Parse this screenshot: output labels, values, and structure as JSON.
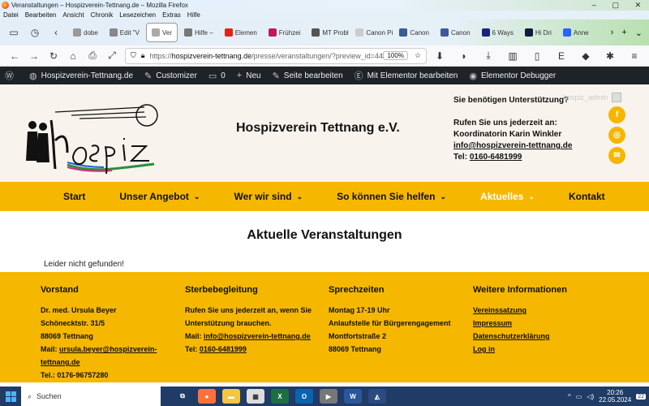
{
  "browser": {
    "window_title": "Veranstaltungen – Hospizverein-Tettnang.de – Mozilla Firefox",
    "menu": [
      "Datei",
      "Bearbeiten",
      "Ansicht",
      "Chronik",
      "Lesezeichen",
      "Extras",
      "Hilfe"
    ],
    "tabs": [
      {
        "label": "dobe",
        "color": "#999999"
      },
      {
        "label": "Edit \"V",
        "color": "#888888"
      },
      {
        "label": "Ver",
        "color": "#aaaaaa",
        "active": true
      },
      {
        "label": "Hilfe –",
        "color": "#777777"
      },
      {
        "label": "Elemen",
        "color": "#e62117"
      },
      {
        "label": "Frühzei",
        "color": "#c2185b"
      },
      {
        "label": "MT Proble",
        "color": "#555555"
      },
      {
        "label": "Canon Pixm",
        "color": "#cccccc"
      },
      {
        "label": "Canon",
        "color": "#3b5998"
      },
      {
        "label": "Canon",
        "color": "#3b5998"
      },
      {
        "label": "6 Ways",
        "color": "#1a237e"
      },
      {
        "label": "Hi Dri",
        "color": "#0d1b3e"
      },
      {
        "label": "Anne",
        "color": "#2962ff"
      }
    ],
    "url_prefix": "https://",
    "url_domain": "hospizverein-tettnang.de",
    "url_path": "/presse/veranstaltungen/?preview_id=44",
    "zoom": "100%"
  },
  "wpbar": {
    "site": "Hospizverein-Tettnang.de",
    "customize": "Customizer",
    "comments": "0",
    "new": "Neu",
    "edit_page": "Seite bearbeiten",
    "elementor": "Mit Elementor bearbeiten",
    "debugger": "Elementor Debugger"
  },
  "header": {
    "site_title": "Hospizverein Tettnang e.V.",
    "contact_question": "Sie benötigen Unterstützung?",
    "contact_line1": "Rufen Sie uns jederzeit an:",
    "contact_line2": "Koordinatorin Karin Winkler",
    "contact_email": "info@hospizverein-tettnang.de",
    "contact_tel_label": "Tel:",
    "contact_tel": "0160-6481999",
    "admin_user": "hospiz_admin"
  },
  "nav": [
    {
      "label": "Start",
      "has_sub": false
    },
    {
      "label": "Unser Angebot",
      "has_sub": true
    },
    {
      "label": "Wer wir sind",
      "has_sub": true
    },
    {
      "label": "So können Sie helfen",
      "has_sub": true
    },
    {
      "label": "Aktuelles",
      "has_sub": true,
      "current": true
    },
    {
      "label": "Kontakt",
      "has_sub": false
    }
  ],
  "content": {
    "heading": "Aktuelle Veranstaltungen",
    "not_found": "Leider nicht gefunden!"
  },
  "footer": {
    "vorstand": {
      "title": "Vorstand",
      "name": "Dr. med. Ursula Beyer",
      "street": "Schönecktstr. 31/5",
      "city": "88069 Tettnang",
      "mail_label": "Mail:",
      "mail_1": "ursula.beyer@hospizverein-",
      "mail_2": "tettnang.de",
      "tel": "Tel.: 0176-96757280"
    },
    "sterbe": {
      "title": "Sterbebegleitung",
      "text_1": "Rufen Sie uns jederzeit an, wenn Sie",
      "text_2": "Unterstützung brauchen.",
      "mail_label": "Mail:",
      "mail": "info@hospizverein-tettnang.de",
      "tel_label": "Tel:",
      "tel": "0160-6481999"
    },
    "sprech": {
      "title": "Sprechzeiten",
      "time": "Montag 17-19 Uhr",
      "place": "Anlaufstelle für Bürgerengagement",
      "street": "Montfortstraße 2",
      "city": "88069 Tettnang"
    },
    "info": {
      "title": "Weitere Informationen",
      "links": [
        "Vereinssatzung",
        "Impressum",
        "Datenschutzerklärung",
        "Log in"
      ]
    }
  },
  "taskbar": {
    "search": "Suchen",
    "time": "20:26",
    "date": "22.05.2024",
    "notif": "22"
  }
}
